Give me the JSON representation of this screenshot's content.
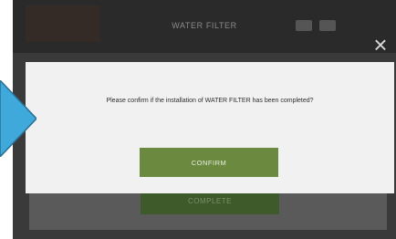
{
  "header": {
    "title": "WATER FILTER"
  },
  "background": {
    "complete_label": "COMPLETE"
  },
  "dialog": {
    "message": "Please confirm if the installation of WATER FILTER has been completed?",
    "confirm_label": "CONFIRM"
  },
  "icons": {
    "close": "close-icon",
    "pointer": "pointer-arrow-icon"
  },
  "colors": {
    "confirm_button": "#6b8a3f",
    "arrow": "#3fa9dc"
  }
}
